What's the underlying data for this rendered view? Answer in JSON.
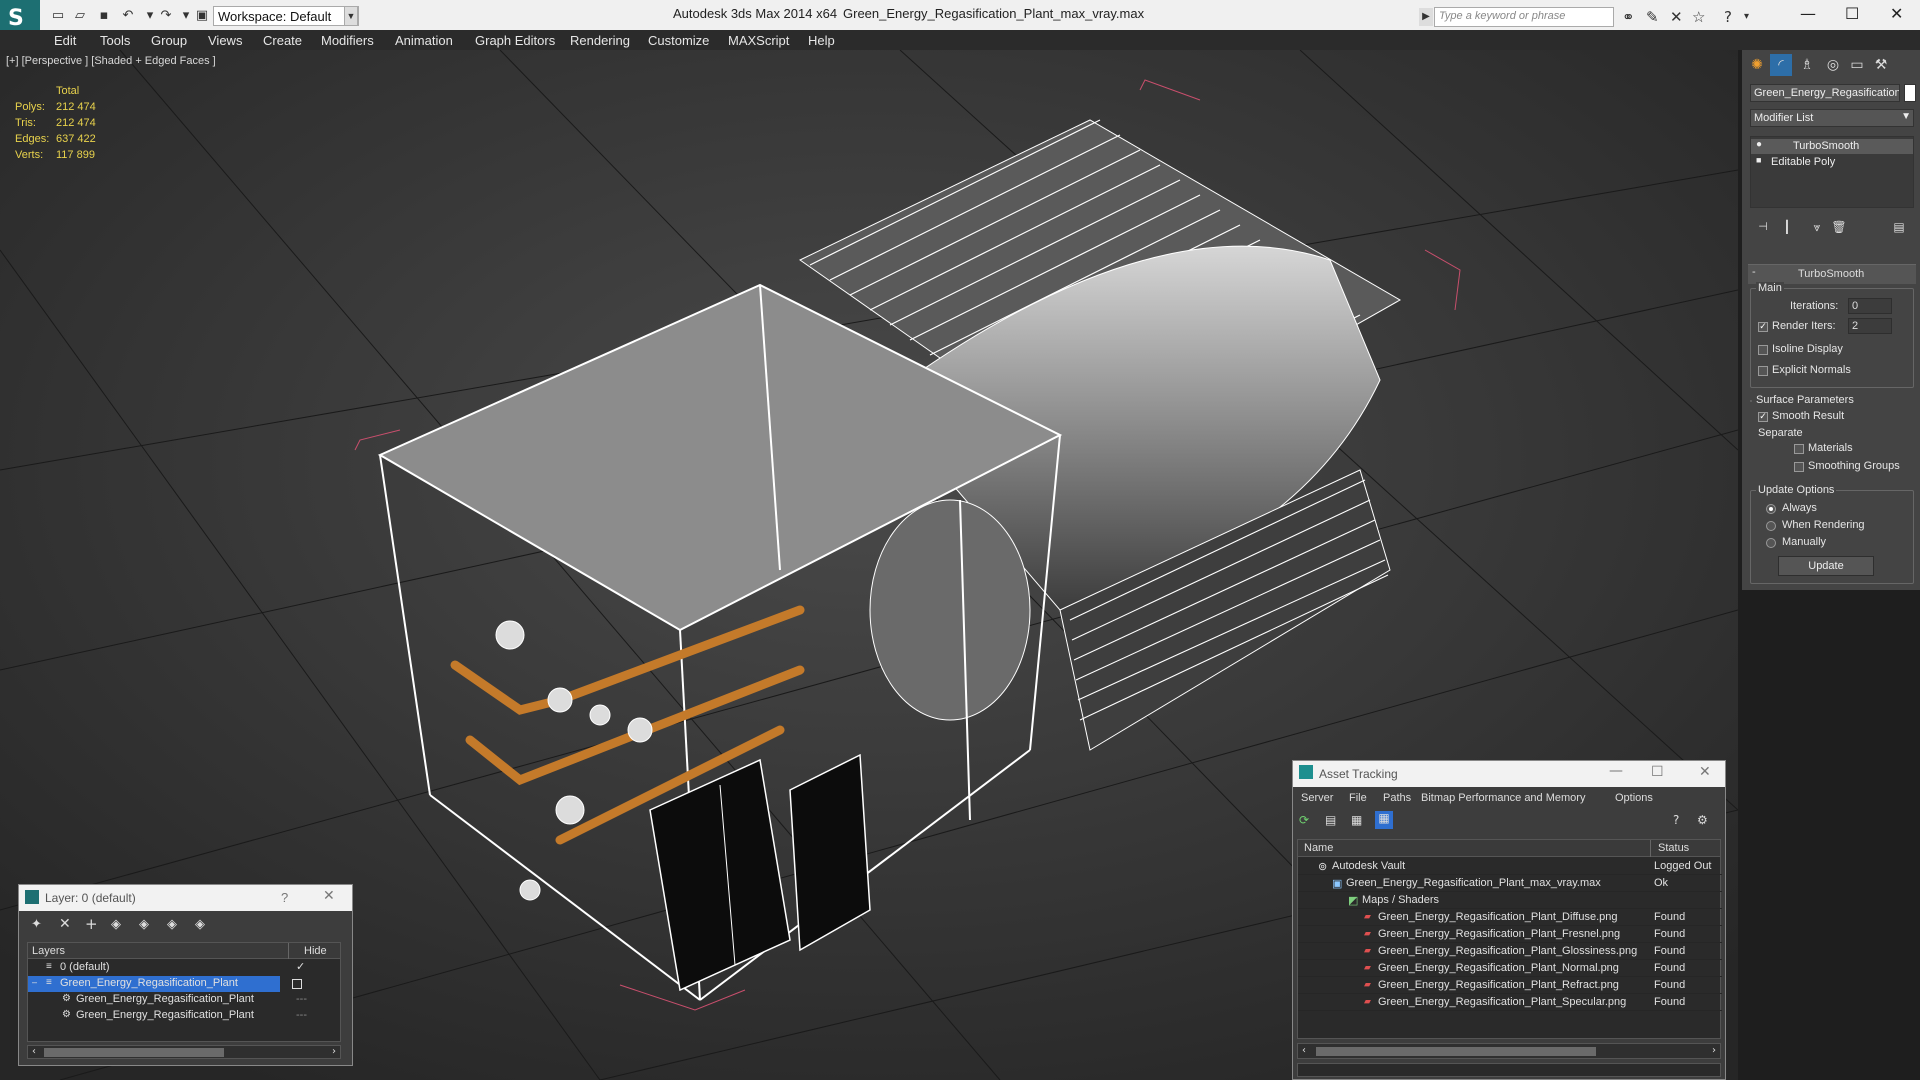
{
  "titlebar": {
    "workspace": "Workspace: Default",
    "app_title": "Autodesk 3ds Max  2014 x64",
    "file_title": "Green_Energy_Regasification_Plant_max_vray.max",
    "search_placeholder": "Type a keyword or phrase"
  },
  "menu": {
    "items": [
      "Edit",
      "Tools",
      "Group",
      "Views",
      "Create",
      "Modifiers",
      "Animation",
      "Graph Editors",
      "Rendering",
      "Customize",
      "MAXScript",
      "Help"
    ]
  },
  "viewport": {
    "label": "[+] [Perspective ] [Shaded + Edged Faces ]",
    "stats": {
      "header": "Total",
      "rows": [
        {
          "label": "Polys:",
          "value": "212 474"
        },
        {
          "label": "Tris:",
          "value": "212 474"
        },
        {
          "label": "Edges:",
          "value": "637 422"
        },
        {
          "label": "Verts:",
          "value": "117 899"
        }
      ]
    }
  },
  "command_panel": {
    "object_name": "Green_Energy_Regasification",
    "modifier_list": "Modifier List",
    "stack": [
      "TurboSmooth",
      "Editable Poly"
    ],
    "rollout_title": "TurboSmooth",
    "main_label": "Main",
    "iterations_label": "Iterations:",
    "iterations_value": "0",
    "render_iters_label": "Render Iters:",
    "render_iters_value": "2",
    "isoline_label": "Isoline Display",
    "explicit_normals_label": "Explicit Normals",
    "surface_params_label": "Surface Parameters",
    "smooth_result_label": "Smooth Result",
    "separate_label": "Separate",
    "materials_label": "Materials",
    "smoothing_groups_label": "Smoothing Groups",
    "update_options_label": "Update Options",
    "always_label": "Always",
    "when_rendering_label": "When Rendering",
    "manually_label": "Manually",
    "update_button": "Update"
  },
  "asset_tracking": {
    "title": "Asset Tracking",
    "menu": [
      "Server",
      "File",
      "Paths",
      "Bitmap Performance and Memory",
      "Options"
    ],
    "col_name": "Name",
    "col_status": "Status",
    "rows": [
      {
        "name": "Autodesk Vault",
        "status": "Logged Out",
        "indent": 1
      },
      {
        "name": "Green_Energy_Regasification_Plant_max_vray.max",
        "status": "Ok",
        "indent": 2
      },
      {
        "name": "Maps / Shaders",
        "status": "",
        "indent": 3
      },
      {
        "name": "Green_Energy_Regasification_Plant_Diffuse.png",
        "status": "Found",
        "indent": 4
      },
      {
        "name": "Green_Energy_Regasification_Plant_Fresnel.png",
        "status": "Found",
        "indent": 4
      },
      {
        "name": "Green_Energy_Regasification_Plant_Glossiness.png",
        "status": "Found",
        "indent": 4
      },
      {
        "name": "Green_Energy_Regasification_Plant_Normal.png",
        "status": "Found",
        "indent": 4
      },
      {
        "name": "Green_Energy_Regasification_Plant_Refract.png",
        "status": "Found",
        "indent": 4
      },
      {
        "name": "Green_Energy_Regasification_Plant_Specular.png",
        "status": "Found",
        "indent": 4
      }
    ]
  },
  "layer_panel": {
    "title": "Layer: 0 (default)",
    "help": "?",
    "col_layers": "Layers",
    "col_hide": "Hide",
    "rows": [
      {
        "name": "0 (default)",
        "indent": 1
      },
      {
        "name": "Green_Energy_Regasification_Plant",
        "indent": 1,
        "selected": true
      },
      {
        "name": "Green_Energy_Regasification_Plant",
        "indent": 2
      },
      {
        "name": "Green_Energy_Regasification_Plant",
        "indent": 2
      }
    ]
  },
  "colors": {
    "viewport_bg": "#3a3a3a",
    "stats_yellow": "#e8d24c",
    "selection_blue": "#2f6fd0",
    "panel_bg": "#444444",
    "logo_teal": "#1d6f72"
  }
}
